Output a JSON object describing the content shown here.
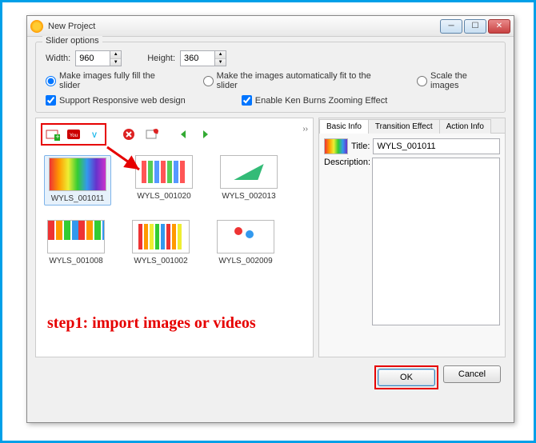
{
  "window": {
    "title": "New Project"
  },
  "slider_options": {
    "legend": "Slider options",
    "width_label": "Width:",
    "width_value": "960",
    "height_label": "Height:",
    "height_value": "360",
    "radios": {
      "fill": "Make images fully fill the slider",
      "auto": "Make the images automatically fit to the slider",
      "scale": "Scale the images"
    },
    "checks": {
      "responsive": "Support Responsive web design",
      "kenburns": "Enable Ken Burns Zooming Effect"
    }
  },
  "thumbs": [
    {
      "name": "WYLS_001011",
      "selected": true
    },
    {
      "name": "WYLS_001020",
      "selected": false
    },
    {
      "name": "WYLS_002013",
      "selected": false
    },
    {
      "name": "WYLS_001008",
      "selected": false
    },
    {
      "name": "WYLS_001002",
      "selected": false
    },
    {
      "name": "WYLS_002009",
      "selected": false
    }
  ],
  "annotation": "step1: import images or videos",
  "tabs": {
    "basic": "Basic Info",
    "transition": "Transition Effect",
    "action": "Action Info"
  },
  "basic_info": {
    "title_label": "Title:",
    "title_value": "WYLS_001011",
    "desc_label": "Description:",
    "desc_value": ""
  },
  "buttons": {
    "ok": "OK",
    "cancel": "Cancel"
  }
}
